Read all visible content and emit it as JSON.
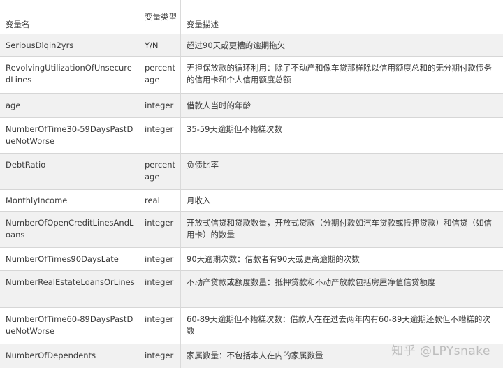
{
  "table": {
    "headers": [
      "变量名",
      "变量类型",
      "变量描述"
    ],
    "rows": [
      {
        "name": "SeriousDlqin2yrs",
        "type": "Y/N",
        "desc": "超过90天或更糟的逾期拖欠"
      },
      {
        "name": "RevolvingUtilizationOfUnsecuredLines",
        "type": "percentage",
        "desc": "无担保放款的循环利用：除了不动产和像车贷那样除以信用额度总和的无分期付款债务的信用卡和个人信用额度总额"
      },
      {
        "name": "age",
        "type": "integer",
        "desc": "借款人当时的年龄"
      },
      {
        "name": "NumberOfTime30-59DaysPastDueNotWorse",
        "type": "integer",
        "desc": "35-59天逾期但不糟糕次数"
      },
      {
        "name": "DebtRatio",
        "type": "percentage",
        "desc": "负债比率"
      },
      {
        "name": "MonthlyIncome",
        "type": "real",
        "desc": "月收入"
      },
      {
        "name": "NumberOfOpenCreditLinesAndLoans",
        "type": "integer",
        "desc": "开放式信贷和贷款数量，开放式贷款（分期付款如汽车贷款或抵押贷款）和信贷（如信用卡）的数量"
      },
      {
        "name": "NumberOfTimes90DaysLate",
        "type": "integer",
        "desc": "90天逾期次数：借款者有90天或更高逾期的次数"
      },
      {
        "name": "NumberRealEstateLoansOrLines",
        "type": "integer",
        "desc": "不动产贷款或额度数量：抵押贷款和不动产放款包括房屋净值信贷额度"
      },
      {
        "name": "NumberOfTime60-89DaysPastDueNotWorse",
        "type": "integer",
        "desc": "60-89天逾期但不糟糕次数：借款人在在过去两年内有60-89天逾期还款但不糟糕的次数"
      },
      {
        "name": "NumberOfDependents",
        "type": "integer",
        "desc": "家属数量：不包括本人在内的家属数量"
      }
    ]
  },
  "watermark": "知乎 @LPYsnake"
}
